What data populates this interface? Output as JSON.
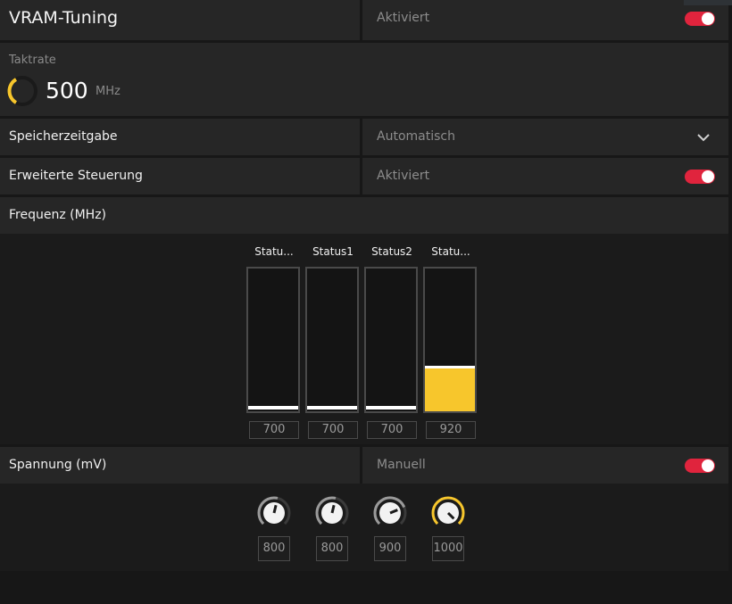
{
  "header": {
    "title": "VRAM-Tuning",
    "status": "Aktiviert",
    "toggle_on": true
  },
  "clock": {
    "label": "Taktrate",
    "value": "500",
    "unit": "MHz"
  },
  "memory_timing": {
    "label": "Speicherzeitgabe",
    "value": "Automatisch"
  },
  "advanced_control": {
    "label": "Erweiterte Steuerung",
    "value": "Aktiviert",
    "toggle_on": true
  },
  "frequency": {
    "label": "Frequenz (MHz)",
    "states": [
      {
        "title": "Statu...",
        "value": "700",
        "level": 0
      },
      {
        "title": "Status1",
        "value": "700",
        "level": 0
      },
      {
        "title": "Status2",
        "value": "700",
        "level": 0
      },
      {
        "title": "Statu...",
        "value": "920",
        "level": 0.3
      }
    ]
  },
  "voltage": {
    "label": "Spannung (mV)",
    "mode": "Manuell",
    "toggle_on": true,
    "knobs": [
      {
        "value": "800",
        "level": 0.55
      },
      {
        "value": "800",
        "level": 0.55
      },
      {
        "value": "900",
        "level": 0.75
      },
      {
        "value": "1000",
        "level": 1.0
      }
    ]
  },
  "colors": {
    "accent": "#f7c62c",
    "toggle": "#e0243d",
    "panel": "#262626",
    "background": "#171717"
  }
}
